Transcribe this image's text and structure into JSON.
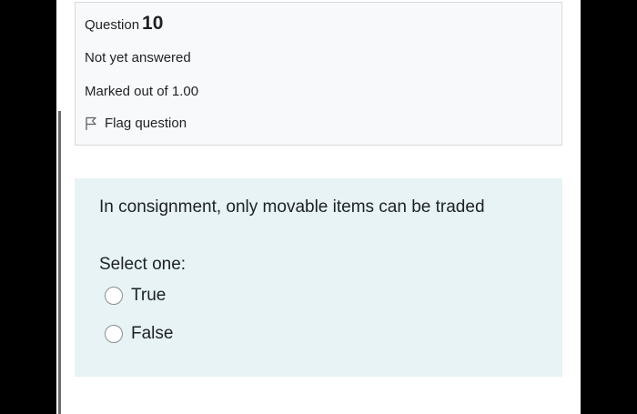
{
  "info": {
    "question_word": "Question",
    "question_number": "10",
    "state": "Not yet answered",
    "grade": "Marked out of 1.00",
    "flag_label": "Flag question",
    "flag_icon": "flag-icon"
  },
  "question": {
    "text": "In consignment, only movable items can be traded",
    "prompt": "Select one:",
    "options": [
      {
        "label": "True",
        "selected": false
      },
      {
        "label": "False",
        "selected": false
      }
    ]
  },
  "colors": {
    "info_background": "#f8f9fa",
    "question_background": "#e7f3f5",
    "side_bars": "#000000"
  }
}
